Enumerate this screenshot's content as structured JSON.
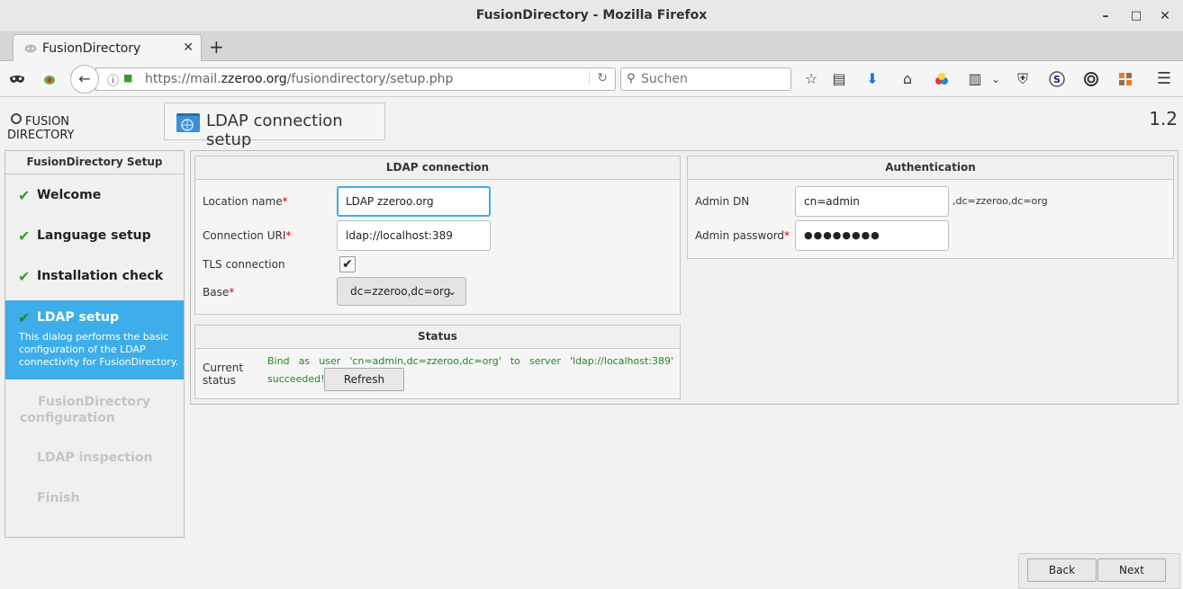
{
  "window": {
    "title": "FusionDirectory - Mozilla Firefox",
    "minimize": "–",
    "maximize": "□",
    "close": "✕"
  },
  "tabs": [
    {
      "label": "FusionDirectory",
      "close": "✕"
    }
  ],
  "newtab": "+",
  "nav": {
    "url_prefix": "https://mail.",
    "url_domain": "zzeroo.org",
    "url_path": "/fusiondirectory/setup.php",
    "search_placeholder": "Suchen"
  },
  "logo": {
    "line1": "FUSION",
    "line2": "DIRECTORY"
  },
  "header": {
    "title": "LDAP connection setup",
    "version": "1.2"
  },
  "sidebar": {
    "title": "FusionDirectory Setup",
    "steps": [
      {
        "label": "Welcome",
        "status": "done"
      },
      {
        "label": "Language setup",
        "status": "done"
      },
      {
        "label": "Installation check",
        "status": "done"
      },
      {
        "label": "LDAP setup",
        "status": "active",
        "description": "This dialog performs the basic configuration of the LDAP connectivity for FusionDirectory."
      },
      {
        "label": "FusionDirectory configuration",
        "status": "pending"
      },
      {
        "label": "LDAP inspection",
        "status": "pending"
      },
      {
        "label": "Finish",
        "status": "pending"
      }
    ],
    "check_glyph": "✔"
  },
  "ldap_connection": {
    "title": "LDAP connection",
    "location_label": "Location name",
    "location_value": "LDAP zzeroo.org",
    "uri_label": "Connection URI",
    "uri_value": "ldap://localhost:389",
    "tls_label": "TLS connection",
    "tls_checked": "✔",
    "base_label": "Base",
    "base_value": "dc=zzeroo,dc=org",
    "required_mark": "*"
  },
  "authentication": {
    "title": "Authentication",
    "admin_dn_label": "Admin DN",
    "admin_dn_value": "cn=admin",
    "admin_dn_suffix": ",dc=zzeroo,dc=org",
    "password_label": "Admin password",
    "password_value": "●●●●●●●●"
  },
  "status": {
    "title": "Status",
    "label_line1": "Current",
    "label_line2": "status",
    "message_line1": "Bind as user 'cn=admin,dc=zzeroo,dc=org' to server 'ldap://localhost:389'",
    "message_line2": "succeeded!",
    "refresh_button": "Refresh"
  },
  "footer": {
    "back_button": "Back",
    "next_button": "Next"
  },
  "colors": {
    "active_step": "#3daee9",
    "success_text": "#1e8a1e",
    "required": "#dd0000"
  }
}
